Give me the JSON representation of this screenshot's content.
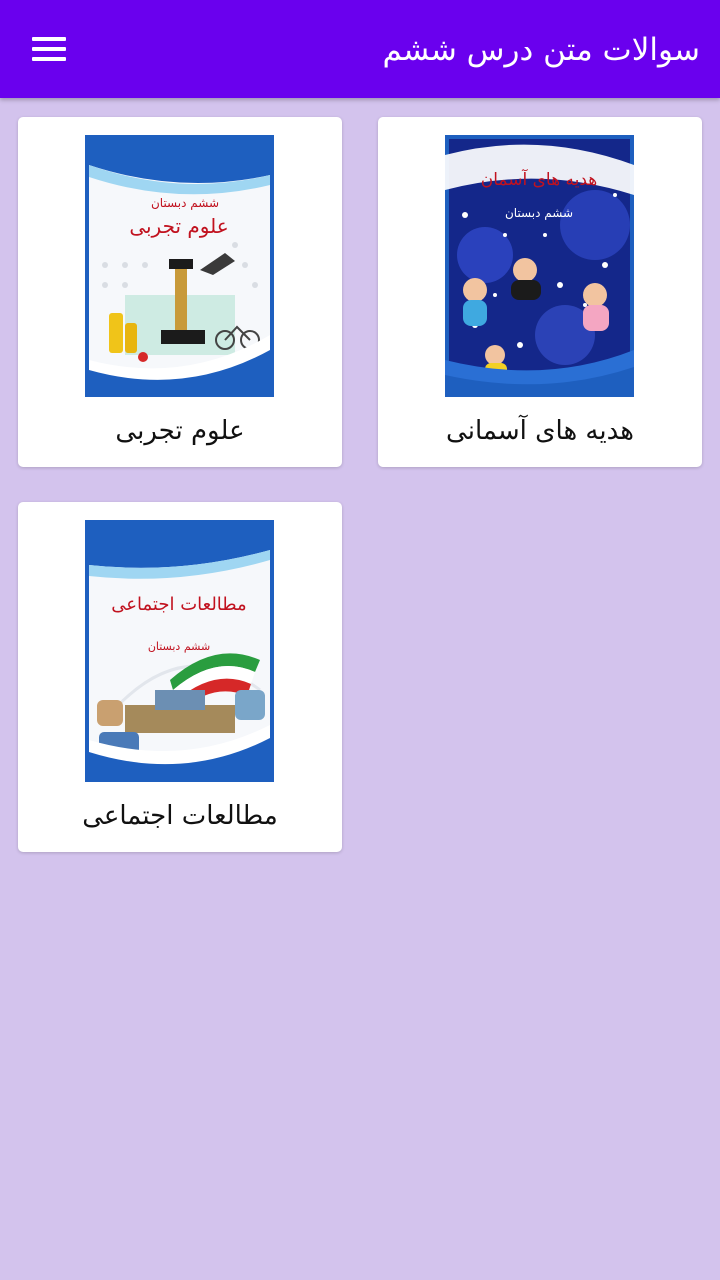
{
  "appbar": {
    "title": "سوالات متن درس ششم",
    "menu_icon": "hamburger-menu-icon",
    "background": "#6a00ee"
  },
  "page": {
    "background": "#d3c3ed"
  },
  "books": [
    {
      "label": "هدیه های آسمانی",
      "cover_title": "هدیه های آسمان",
      "cover_subtitle": "ششم دبستان"
    },
    {
      "label": "علوم تجربی",
      "cover_title": "علوم تجربی",
      "cover_subtitle": "ششم دبستان"
    },
    {
      "label": "مطالعات اجتماعی",
      "cover_title": "مطالعات اجتماعی",
      "cover_subtitle": "ششم دبستان"
    }
  ]
}
